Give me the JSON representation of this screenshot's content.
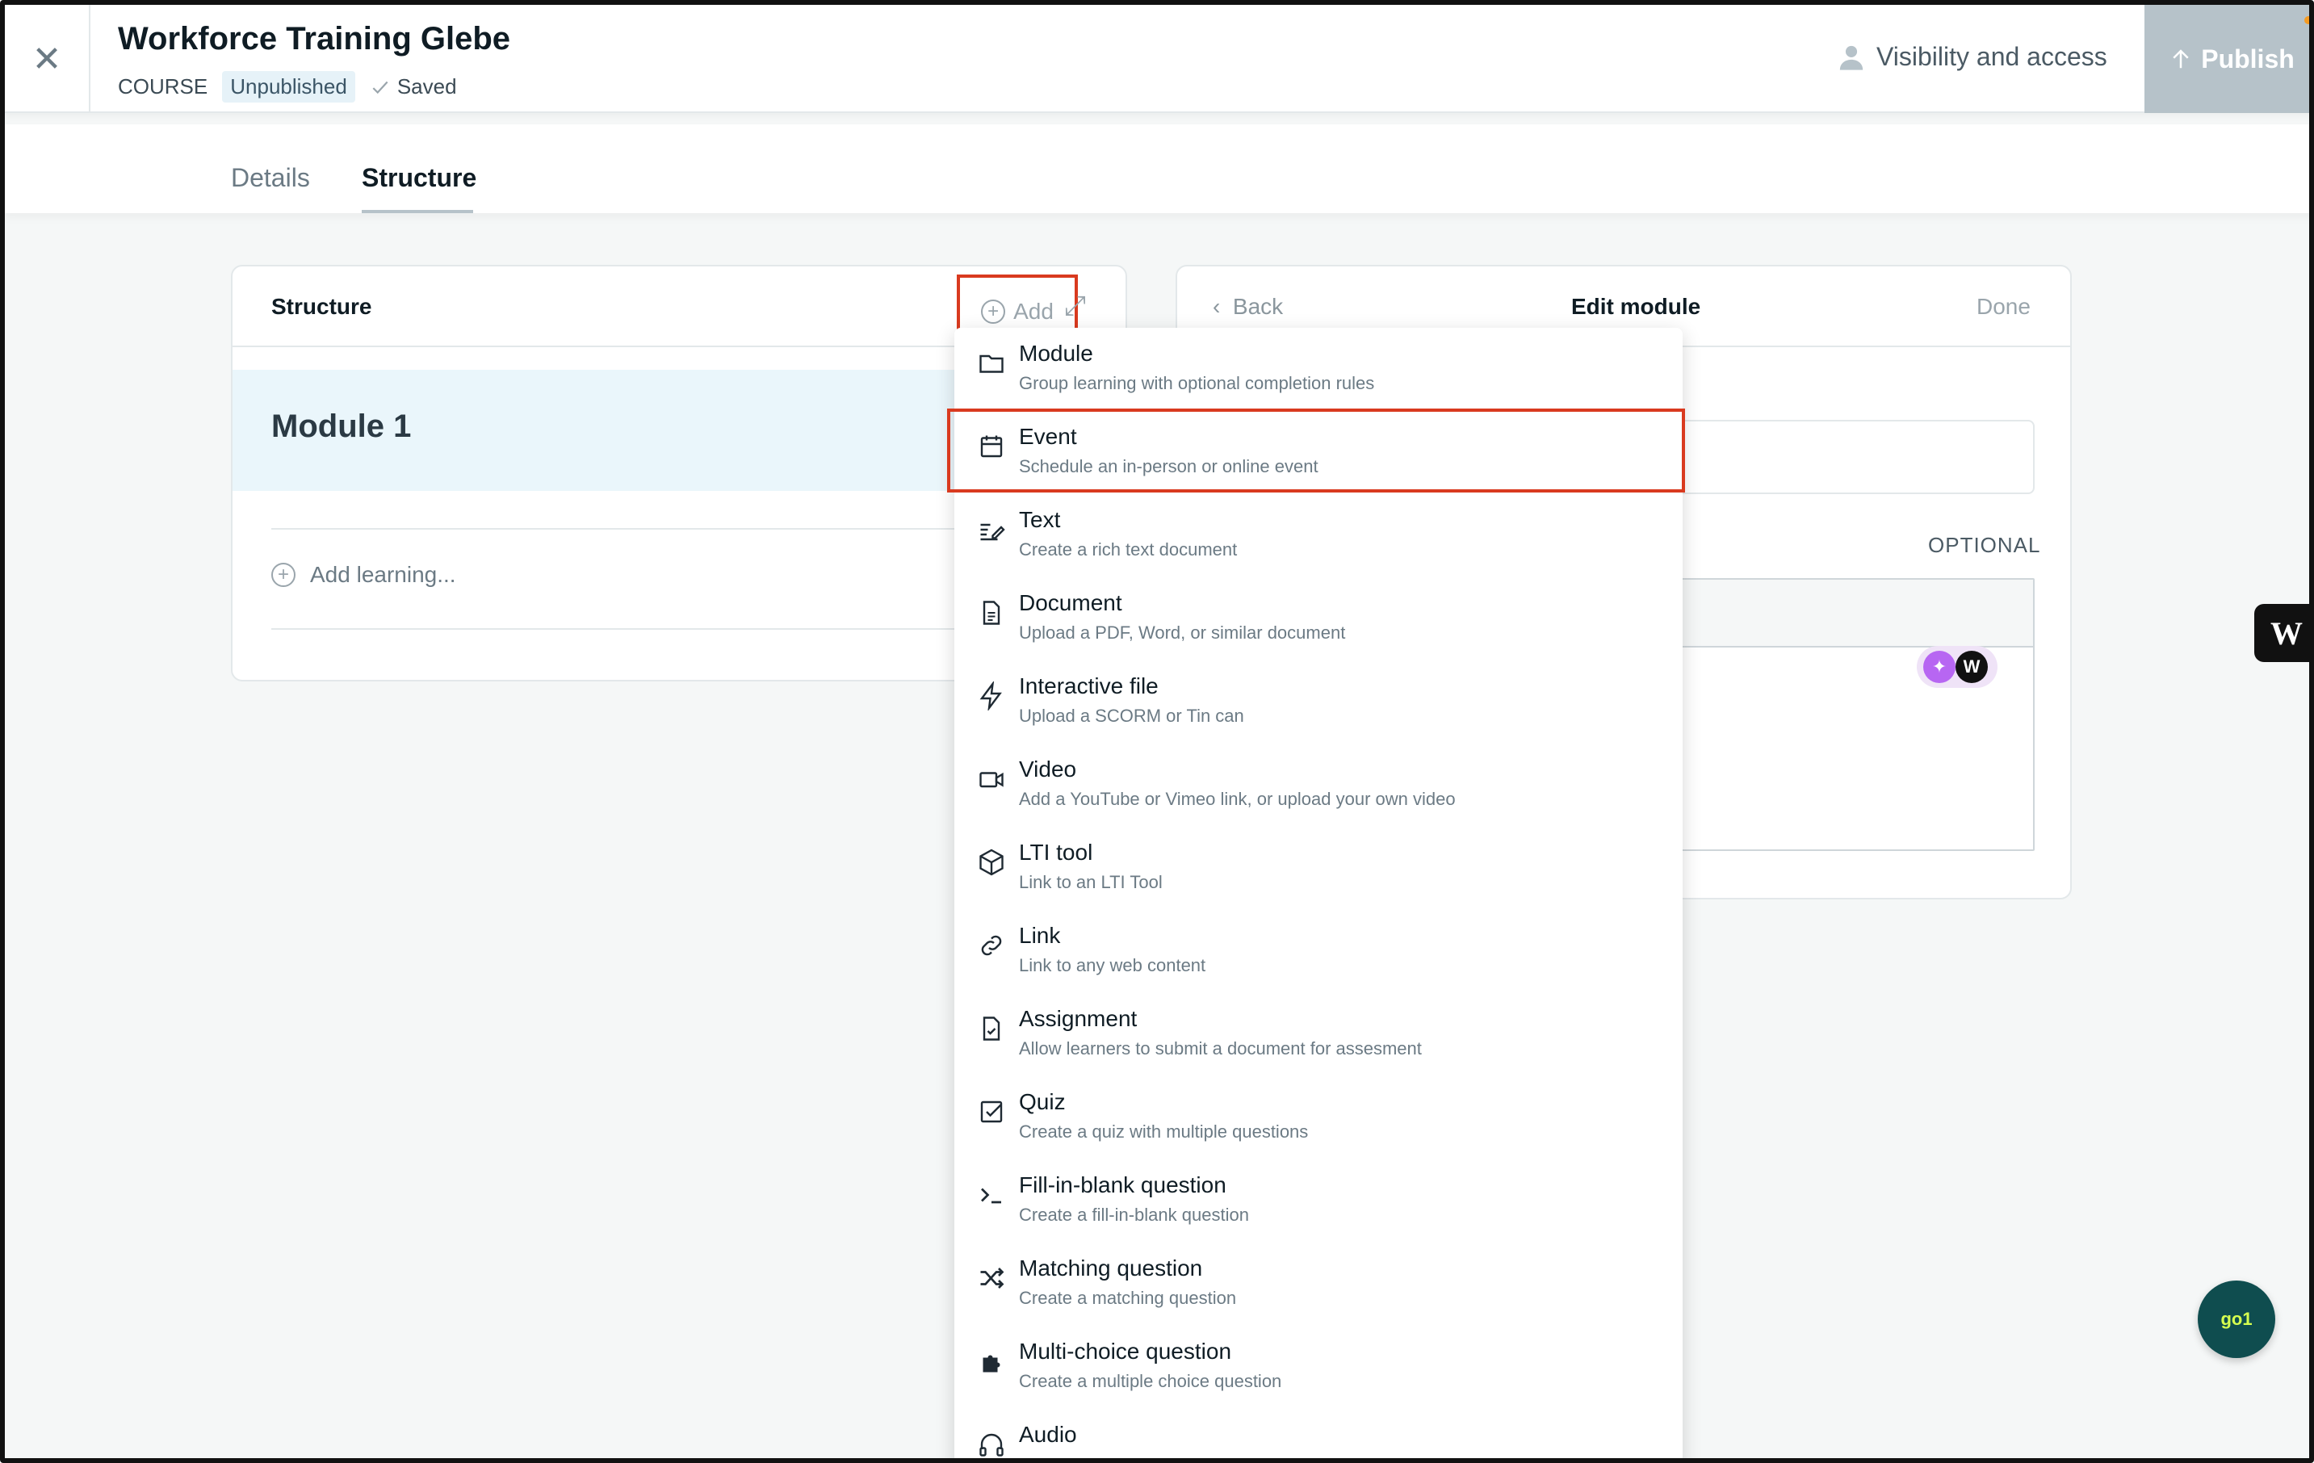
{
  "header": {
    "close_icon": "close-icon",
    "title": "Workforce Training Glebe",
    "type_label": "COURSE",
    "status_badge": "Unpublished",
    "saved_label": "Saved",
    "visibility_label": "Visibility and access",
    "publish_label": "Publish"
  },
  "tabs": [
    {
      "label": "Details",
      "active": false
    },
    {
      "label": "Structure",
      "active": true
    }
  ],
  "structure_panel": {
    "title": "Structure",
    "add_label": "Add",
    "module_title": "Module 1",
    "add_learning_label": "Add learning..."
  },
  "edit_panel": {
    "back_label": "Back",
    "title": "Edit module",
    "done_label": "Done",
    "optional_label": "OPTIONAL"
  },
  "menu": [
    {
      "label": "Module",
      "desc": "Group learning with optional completion rules",
      "icon": "folder-icon"
    },
    {
      "label": "Event",
      "desc": "Schedule an in-person or online event",
      "icon": "calendar-icon",
      "highlighted": true
    },
    {
      "label": "Text",
      "desc": "Create a rich text document",
      "icon": "text-edit-icon"
    },
    {
      "label": "Document",
      "desc": "Upload a PDF, Word, or similar document",
      "icon": "document-icon"
    },
    {
      "label": "Interactive file",
      "desc": "Upload a SCORM or Tin can",
      "icon": "lightning-icon"
    },
    {
      "label": "Video",
      "desc": "Add a YouTube or Vimeo link, or upload your own video",
      "icon": "video-icon"
    },
    {
      "label": "LTI tool",
      "desc": "Link to an LTI Tool",
      "icon": "cube-icon"
    },
    {
      "label": "Link",
      "desc": "Link to any web content",
      "icon": "link-icon"
    },
    {
      "label": "Assignment",
      "desc": "Allow learners to submit a document for assesment",
      "icon": "assignment-icon"
    },
    {
      "label": "Quiz",
      "desc": "Create a quiz with multiple questions",
      "icon": "checkbox-icon"
    },
    {
      "label": "Fill-in-blank question",
      "desc": "Create a fill-in-blank question",
      "icon": "prompt-icon"
    },
    {
      "label": "Matching question",
      "desc": "Create a matching question",
      "icon": "shuffle-icon"
    },
    {
      "label": "Multi-choice question",
      "desc": "Create a multiple choice question",
      "icon": "puzzle-icon"
    },
    {
      "label": "Audio",
      "desc": "",
      "icon": "headphones-icon"
    }
  ],
  "widgets": {
    "w_tab_label": "W",
    "ai_badge_label": "W",
    "go1_label": "go1"
  },
  "colors": {
    "highlight": "#d93a1f",
    "publish_bg": "#b6c2c9",
    "module_bg": "#eaf6fb",
    "go1_bg": "#0f4d4f"
  }
}
